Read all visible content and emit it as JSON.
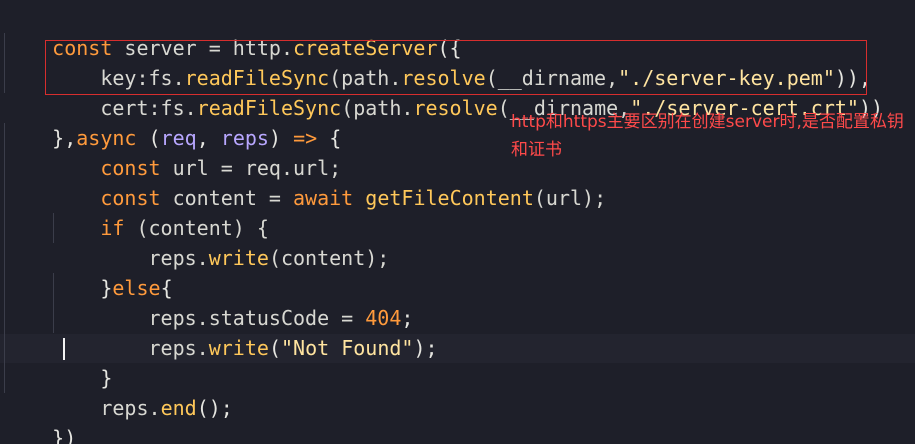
{
  "code": {
    "line1": {
      "a": "const",
      "b": " server = http.",
      "c": "createServer",
      "d": "({"
    },
    "line2": {
      "indent": "    ",
      "a": "key",
      "b": ":fs.",
      "c": "readFileSync",
      "d": "(path.",
      "e": "resolve",
      "f": "(__dirname,",
      "g": "\"./server-key.pem\"",
      "h": ")),"
    },
    "line3": {
      "indent": "    ",
      "a": "cert",
      "b": ":fs.",
      "c": "readFileSync",
      "d": "(path.",
      "e": "resolve",
      "f": "(__dirname,",
      "g": "\"./server-cert.crt\"",
      "h": "))"
    },
    "line4": {
      "a": "},",
      "b": "async",
      "c": " (",
      "d": "req",
      "e": ", ",
      "f": "reps",
      "g": ") ",
      "h": "=>",
      "i": " {"
    },
    "line5": {
      "indent": "    ",
      "a": "const",
      "b": " url = req.url;"
    },
    "line6": {
      "indent": "    ",
      "a": "const",
      "b": " content = ",
      "c": "await",
      "d": " ",
      "e": "getFileContent",
      "f": "(url);"
    },
    "line7": {
      "indent": "    ",
      "a": "if",
      "b": " (content) {"
    },
    "line8": {
      "indent": "        ",
      "a": "reps.",
      "b": "write",
      "c": "(content);"
    },
    "line9": {
      "indent": "    ",
      "a": "}",
      "b": "else",
      "c": "{"
    },
    "line10": {
      "indent": "        ",
      "a": "reps.statusCode = ",
      "b": "404",
      "c": ";"
    },
    "line11": {
      "indent": "        ",
      "a": "reps.",
      "b": "write",
      "c": "(",
      "d": "\"Not Found\"",
      "e": ");"
    },
    "line12": {
      "indent": "    ",
      "a": "}"
    },
    "line13": {
      "indent": "    ",
      "a": "reps.",
      "b": "end",
      "c": "();"
    },
    "line14": {
      "a": "})"
    }
  },
  "annotation": {
    "text": "http和https主要区别在创建server时,是否配置私钥和证书",
    "color": "#ff4a4a",
    "box_color": "#d72e2e"
  },
  "colors": {
    "background": "#1e1f29",
    "keyword": "#ff9a3c",
    "function": "#ffc85a",
    "string": "#ffe4a0",
    "parameter": "#b8a7ff",
    "text": "#d8d8d2"
  }
}
